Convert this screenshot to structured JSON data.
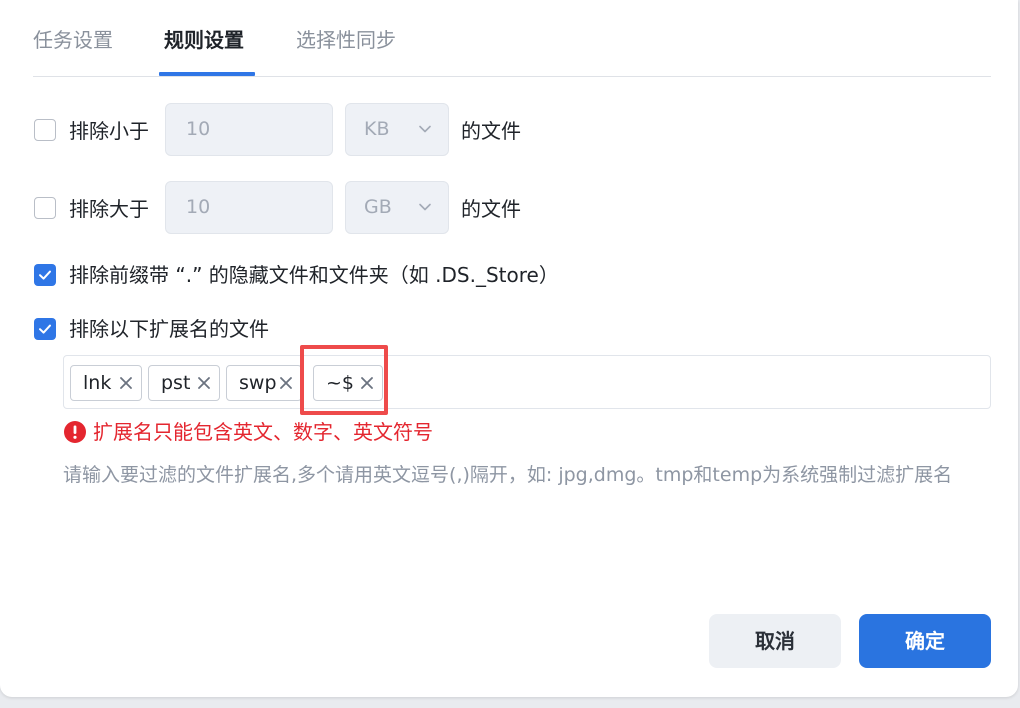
{
  "tabs": [
    {
      "label": "任务设置",
      "active": false
    },
    {
      "label": "规则设置",
      "active": true
    },
    {
      "label": "选择性同步",
      "active": false
    }
  ],
  "rules": {
    "min_size": {
      "checked": false,
      "label": "排除小于",
      "value": "10",
      "unit": "KB",
      "suffix": "的文件"
    },
    "max_size": {
      "checked": false,
      "label": "排除大于",
      "value": "10",
      "unit": "GB",
      "suffix": "的文件"
    },
    "hidden_files": {
      "checked": true,
      "label": "排除前缀带 “.” 的隐藏文件和文件夹（如 .DS._Store）"
    },
    "extensions": {
      "checked": true,
      "label": "排除以下扩展名的文件",
      "tags": [
        "lnk",
        "pst",
        "swp",
        "~$"
      ],
      "error": "扩展名只能包含英文、数字、英文符号",
      "hint": "请输入要过滤的文件扩展名,多个请用英文逗号(,)隔开，如: jpg,dmg。tmp和temp为系统强制过滤扩展名"
    }
  },
  "buttons": {
    "cancel": "取消",
    "confirm": "确定"
  },
  "colors": {
    "accent": "#2f76e6",
    "error": "#e4262f",
    "highlight": "#ee4b4b"
  },
  "icons": {
    "checkbox_checked": "check-icon",
    "dropdown": "chevron-down-icon",
    "tag_remove": "close-icon",
    "error": "error-icon"
  }
}
